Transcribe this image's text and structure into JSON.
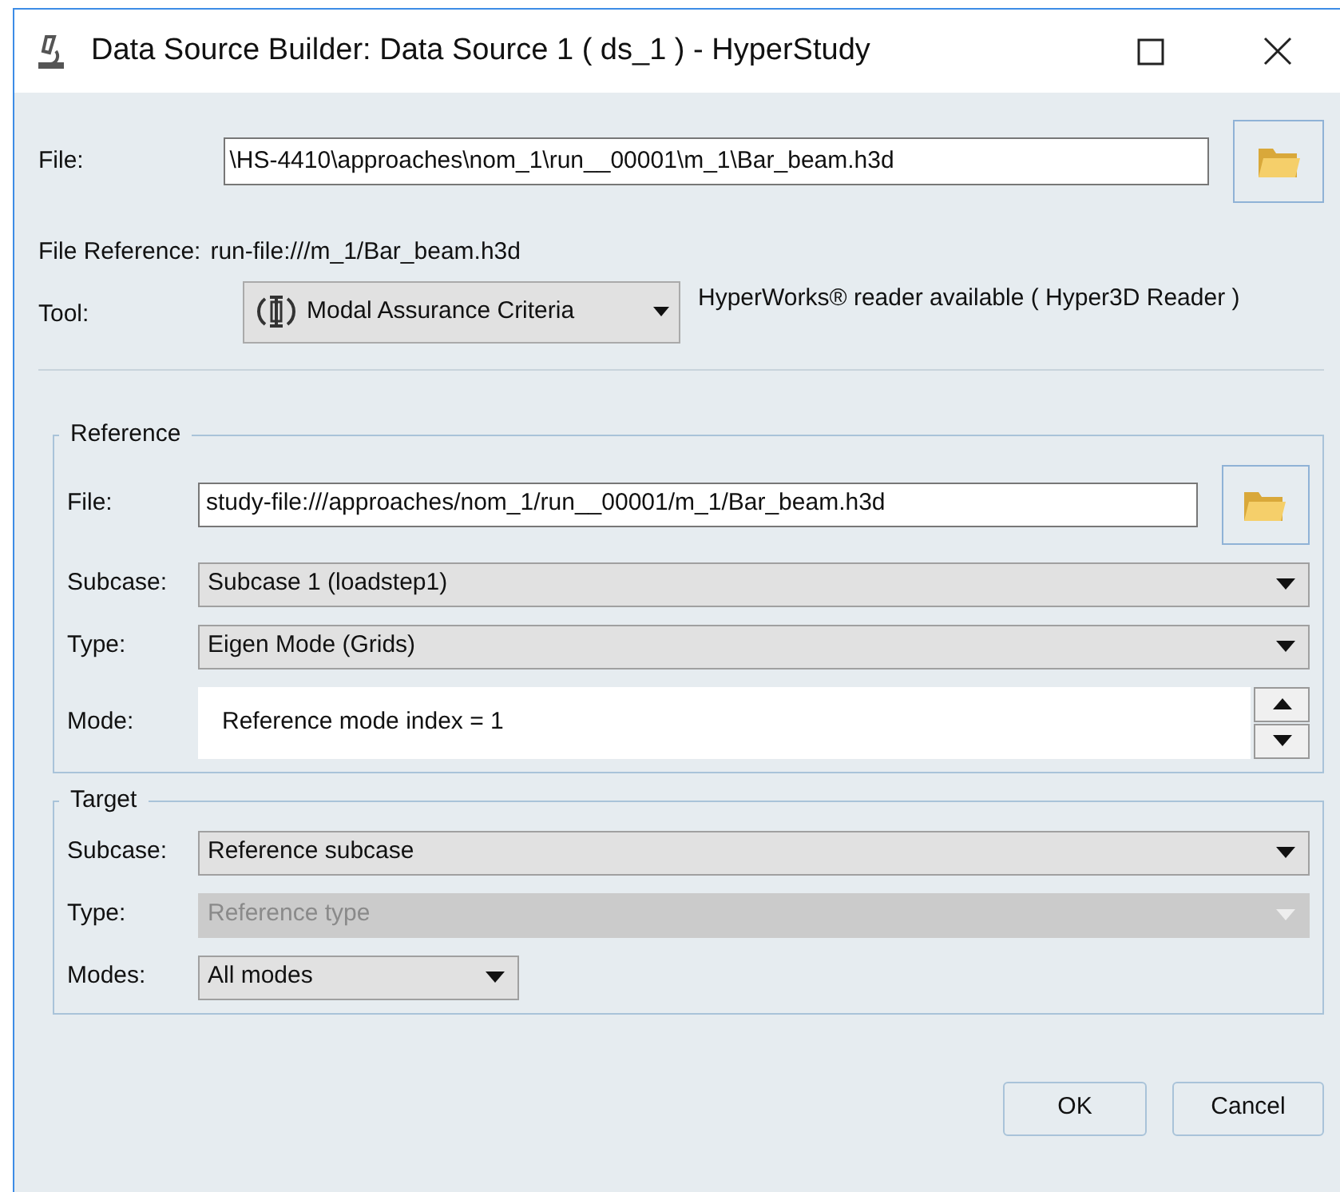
{
  "window": {
    "title": "Data Source Builder: Data Source 1 ( ds_1 ) - HyperStudy"
  },
  "file": {
    "label": "File:",
    "value": "\\HS-4410\\approaches\\nom_1\\run__00001\\m_1\\Bar_beam.h3d"
  },
  "file_reference": {
    "label": "File Reference:",
    "value": "run-file:///m_1/Bar_beam.h3d"
  },
  "tool": {
    "label": "Tool:",
    "value": "Modal Assurance Criteria"
  },
  "reader_status": "HyperWorks® reader available ( Hyper3D Reader )",
  "groups": [
    {
      "title": "Reference",
      "fields": [
        {
          "kind": "file",
          "label": "File:",
          "value": "study-file:///approaches/nom_1/run__00001/m_1/Bar_beam.h3d"
        },
        {
          "kind": "select",
          "label": "Subcase:",
          "value": "Subcase 1 (loadstep1)",
          "disabled": false,
          "wide": true
        },
        {
          "kind": "select",
          "label": "Type:",
          "value": "Eigen Mode (Grids)",
          "disabled": false,
          "wide": true
        },
        {
          "kind": "spinner",
          "label": "Mode:",
          "value": "Reference mode index = 1"
        }
      ]
    },
    {
      "title": "Target",
      "fields": [
        {
          "kind": "select",
          "label": "Subcase:",
          "value": "Reference subcase",
          "disabled": false,
          "wide": true
        },
        {
          "kind": "select",
          "label": "Type:",
          "value": "Reference type",
          "disabled": true,
          "wide": true
        },
        {
          "kind": "select",
          "label": "Modes:",
          "value": "All modes",
          "disabled": false,
          "wide": false
        }
      ]
    }
  ],
  "buttons": [
    "OK",
    "Cancel"
  ]
}
